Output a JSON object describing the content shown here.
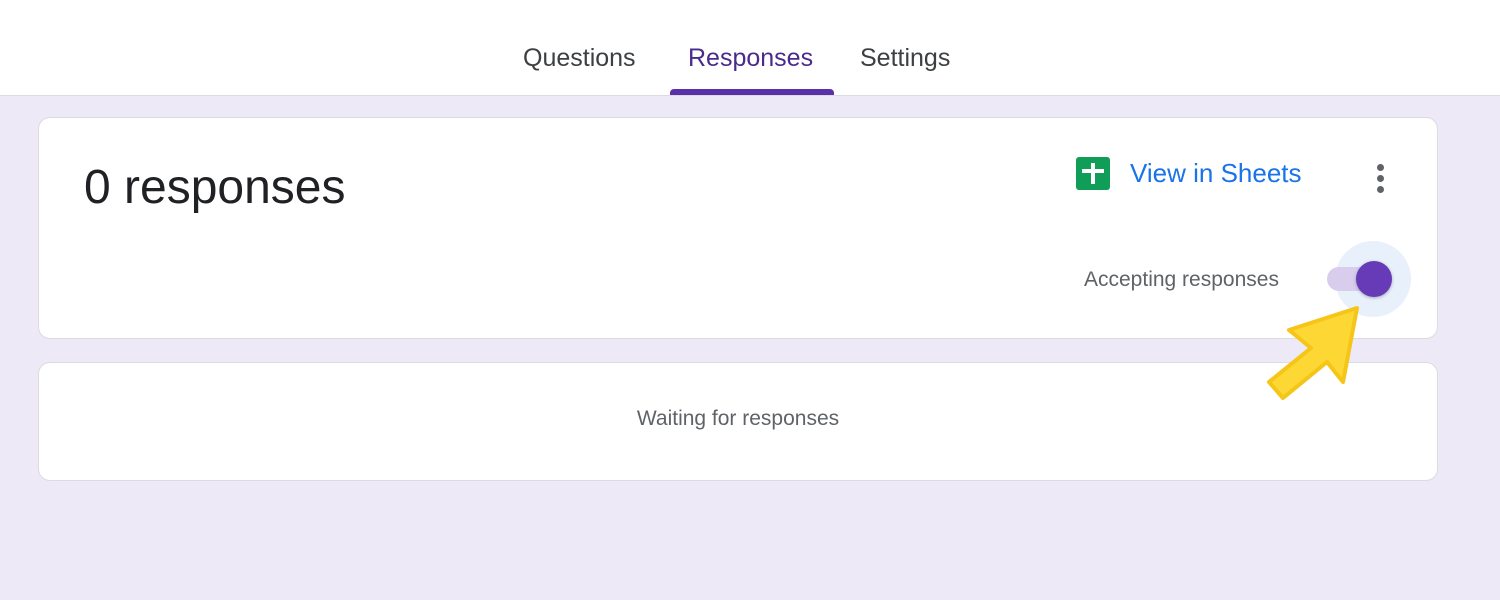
{
  "tabs": [
    {
      "label": "Questions",
      "active": false
    },
    {
      "label": "Responses",
      "active": true
    },
    {
      "label": "Settings",
      "active": false
    }
  ],
  "summary": {
    "count_text": "0 responses",
    "view_in_sheets_label": "View in Sheets",
    "sheets_icon": "sheets-icon",
    "more_icon": "more-vert-icon",
    "accepting_label": "Accepting responses",
    "accepting_enabled": true
  },
  "empty_state": {
    "text": "Waiting for responses"
  },
  "colors": {
    "accent": "#673ab7",
    "tab_active": "#4b2a8c",
    "link": "#1a73e8",
    "sheets_green": "#0f9d58",
    "page_background": "#ede9f6",
    "annotation_arrow": "#fdd835"
  }
}
